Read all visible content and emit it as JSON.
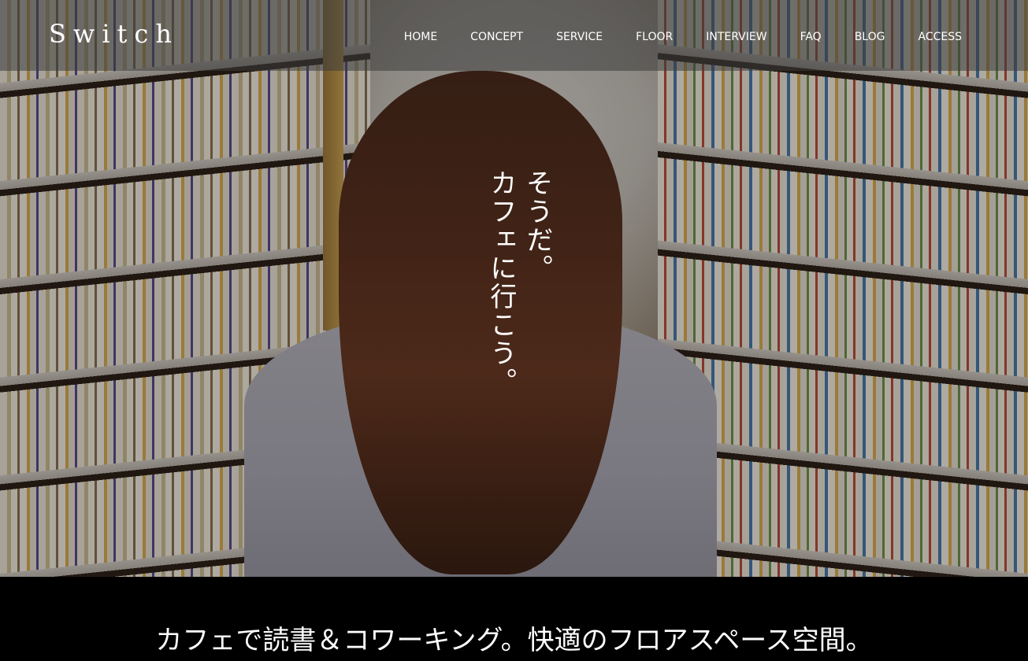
{
  "header": {
    "logo": "Switch",
    "nav": [
      "HOME",
      "CONCEPT",
      "SERVICE",
      "FLOOR",
      "INTERVIEW",
      "FAQ",
      "BLOG",
      "ACCESS"
    ]
  },
  "hero": {
    "catch_line1": "そうだ。",
    "catch_line2": "カフェに行こう。"
  },
  "band": {
    "headline": "カフェで読書＆コワーキング。快適のフロアスペース空間。"
  }
}
